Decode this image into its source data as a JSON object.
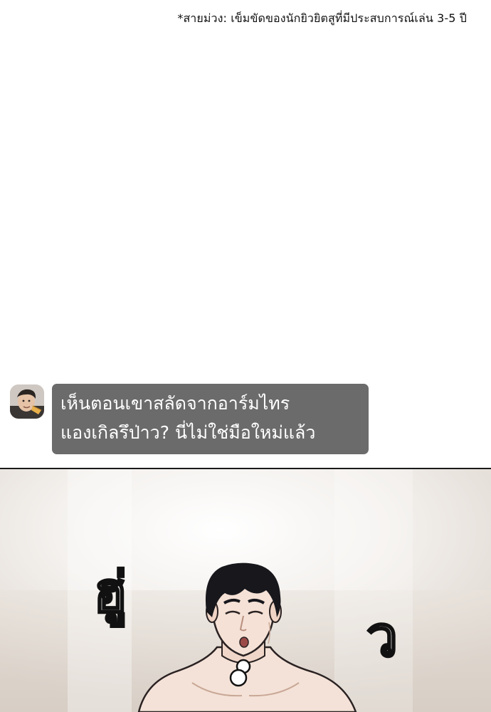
{
  "footnote": "*สายม่วง: เข็มขัดของนักยิวยิตสูที่มีประสบการณ์เล่น 3-5 ปี",
  "comment": {
    "line1": "เห็นตอนเขาสลัดจากอาร์มไทร",
    "line2": "แองเกิลรึป่าว? นี่ไม่ใช่มือใหม่แล้ว"
  },
  "panel": {
    "sfx_left": "ฮู่",
    "sfx_right": "ว"
  },
  "colors": {
    "bubble": "#6b6b6b",
    "bubble_text": "#ffffff",
    "divider": "#1a1a1a",
    "hair": "#17171c",
    "skin": "#f2ddd2"
  }
}
